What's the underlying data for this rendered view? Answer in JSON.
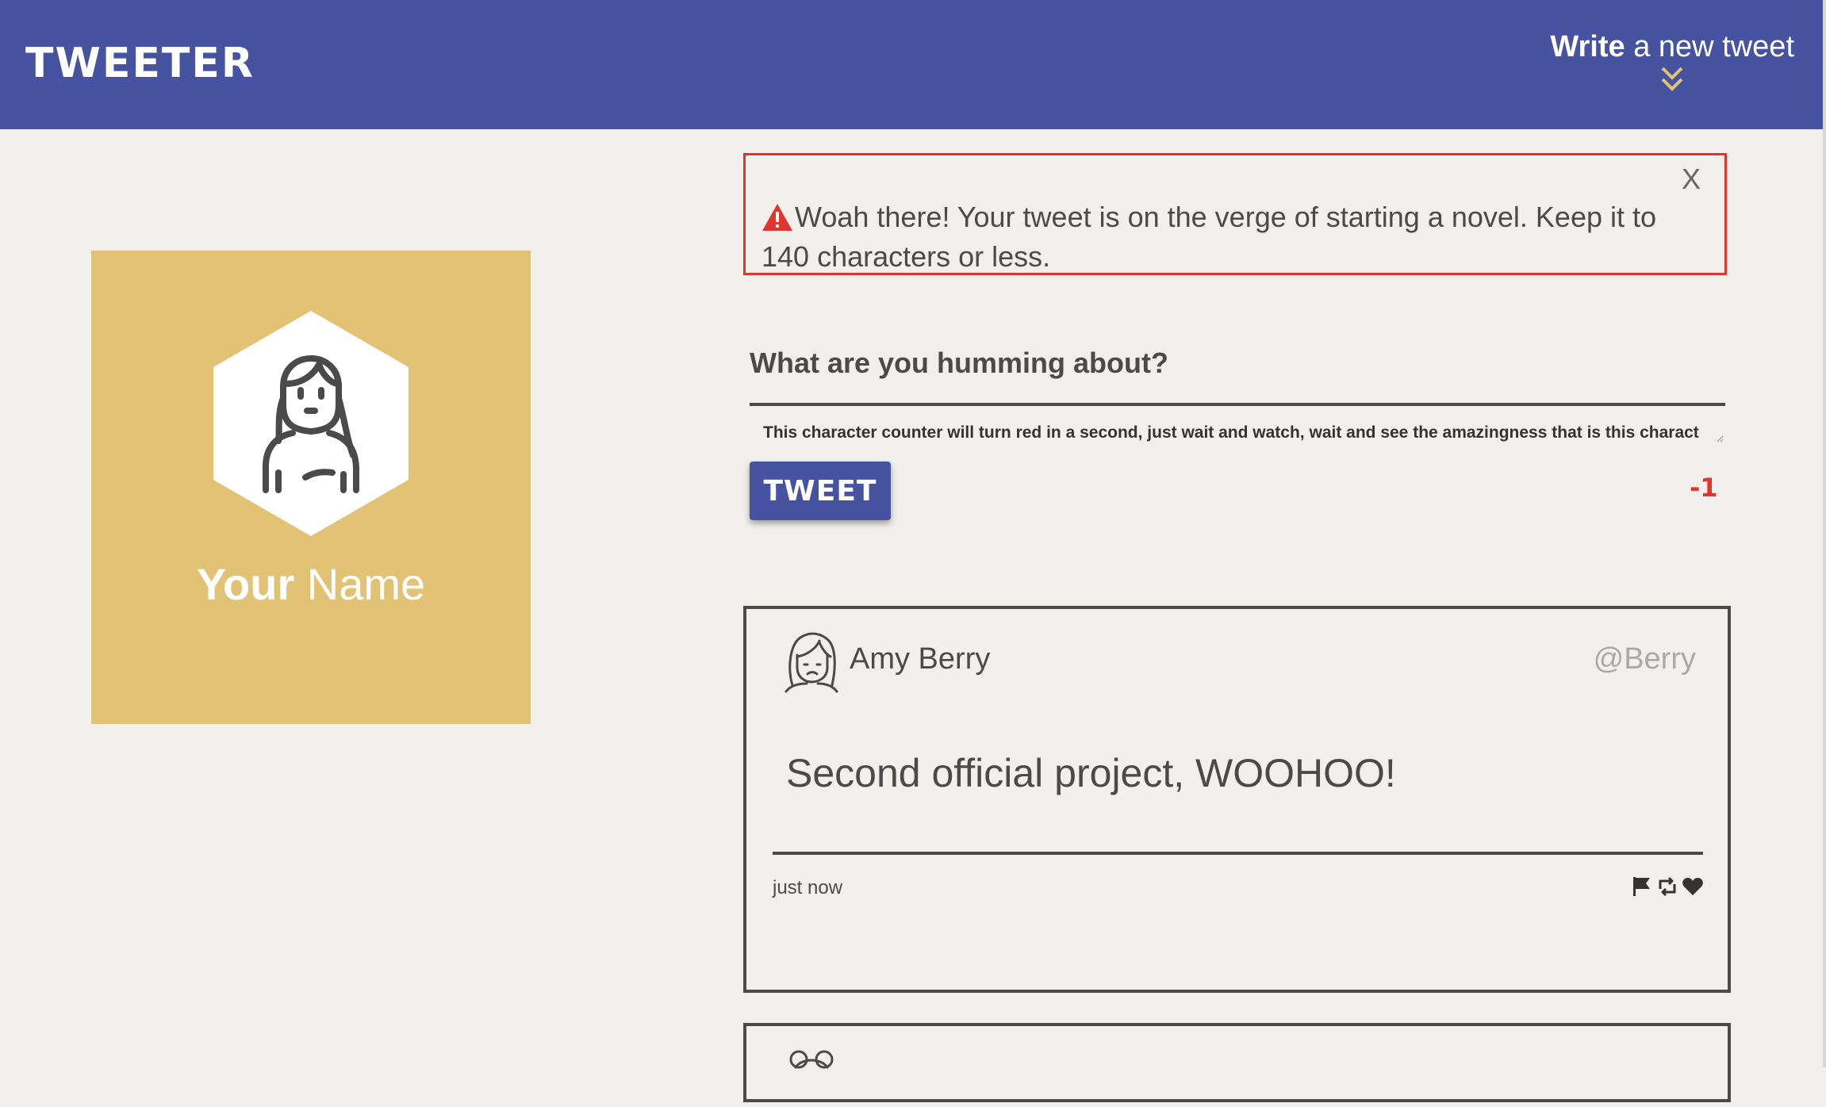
{
  "nav": {
    "brand": "TWEETER",
    "compose_bold": "Write",
    "compose_rest": " a new tweet",
    "arrow_icon": "double-chevron-down-icon",
    "arrow_color": "#e2c274",
    "bg_color": "#4653a0"
  },
  "profile": {
    "name_bold": "Your",
    "name_rest": " Name",
    "bg_color": "#e2c274"
  },
  "error": {
    "message": "Woah there! Your tweet is on the verge of starting a novel. Keep it to 140 characters or less.",
    "close_label": "X",
    "icon": "warning-icon",
    "color": "#e0352d"
  },
  "composer": {
    "prompt": "What are you humming about?",
    "input_value": "This character counter will turn red in a second, just wait and watch, wait and see the amazingness that is this character",
    "button_label": "TWEET",
    "counter": "-1",
    "counter_color": "#e0352d"
  },
  "tweets": [
    {
      "author": "Amy Berry",
      "handle": "@Berry",
      "content": "Second official project, WOOHOO!",
      "time": "just now",
      "actions": [
        "flag-icon",
        "retweet-icon",
        "heart-icon"
      ]
    }
  ]
}
